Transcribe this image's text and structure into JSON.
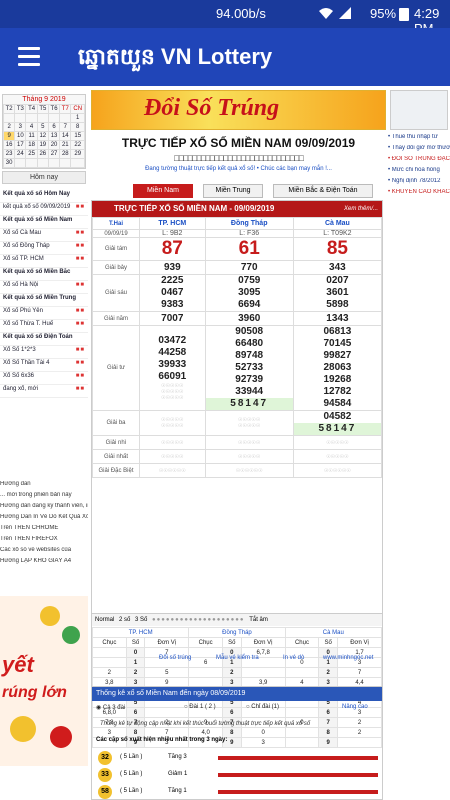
{
  "status": {
    "speed": "94.00b/s",
    "battery": "95%",
    "time": "4:29 PM"
  },
  "app": {
    "title": "ឆ្នោតយួន VN Lottery"
  },
  "left": {
    "calendar_title": "Tháng 9 2019",
    "calendar_days": [
      "T2",
      "T3",
      "T4",
      "T5",
      "T6",
      "T7",
      "CN"
    ],
    "calendar_rows": [
      [
        "",
        "",
        "",
        "",
        "",
        "",
        "1"
      ],
      [
        "2",
        "3",
        "4",
        "5",
        "6",
        "7",
        "8"
      ],
      [
        "9",
        "10",
        "11",
        "12",
        "13",
        "14",
        "15"
      ],
      [
        "16",
        "17",
        "18",
        "19",
        "20",
        "21",
        "22"
      ],
      [
        "23",
        "24",
        "25",
        "26",
        "27",
        "28",
        "29"
      ],
      [
        "30",
        "",
        "",
        "",
        "",
        "",
        ""
      ]
    ],
    "today": "Hôm nay",
    "menu": [
      {
        "text": "Kết quả xổ số Hôm Nay",
        "sec": true
      },
      {
        "text": "kết quả xổ số 09/09/2019",
        "sec": false
      },
      {
        "text": "Kết quả xổ số Miền Nam",
        "sec": true
      },
      {
        "text": "Xổ số Cà Mau",
        "sec": false
      },
      {
        "text": "Xổ số Đồng Tháp",
        "sec": false
      },
      {
        "text": "Xổ số TP. HCM",
        "sec": false
      },
      {
        "text": "Kết quả xổ số Miền Bắc",
        "sec": true
      },
      {
        "text": "Xổ số Hà Nội",
        "sec": false
      },
      {
        "text": "Kết quả xổ số Miền Trung",
        "sec": true
      },
      {
        "text": "Xổ số Phú Yên",
        "sec": false
      },
      {
        "text": "Xổ số Thừa T. Huế",
        "sec": false
      },
      {
        "text": "Kết quả xổ số Điện Toán",
        "sec": true
      },
      {
        "text": "Xổ Số 1*2*3",
        "sec": false
      },
      {
        "text": "Xổ Số Thần Tài 4",
        "sec": false
      },
      {
        "text": "Xổ Số 6x36",
        "sec": false
      },
      {
        "text": "đang xổ, mới",
        "sec": false
      }
    ],
    "bottom": [
      "Hướng dẫn",
      "... mới trong phiên bản này",
      "Hướng dẫn đăng ký thành viên, in",
      "Hướng Dẫn In Vé Dò Kết Quả Xổ",
      "Trên TRÊN CHROME",
      "Trên TRÊN FIREFOX",
      "Các xổ số về websites của",
      "Hướng LẬP KHỔ GIẤY A4"
    ],
    "ad_line1": "yết",
    "ad_line2": "rúng lớn"
  },
  "center": {
    "banner": "Đổi Số Trúng",
    "title": "TRỰC TIẾP XỔ SỐ MIỀN NAM 09/09/2019",
    "boxes": "□□□□□□□□□□□□□□□□□□□□□□□□□□□□□",
    "note": "Đang tường thuật trực tiếp kết quả xổ số! • Chúc các bạn may mắn !...",
    "tabs": [
      "Miền Nam",
      "Miền Trung",
      "Miền Bắc & Điện Toán"
    ],
    "results_head": "TRỰC TIẾP XỔ SỐ MIỀN NAM - 09/09/2019",
    "more": "Xem thêm/...",
    "col_label": "T.Hai",
    "provinces": [
      "TP. HCM",
      "Đồng Tháp",
      "Cà Mau"
    ],
    "date": "09/09/19",
    "codes": [
      "L: 9B2",
      "L: F36",
      "L: T09K2"
    ],
    "prizes": [
      {
        "label": "Giải tám",
        "values": [
          [
            "87"
          ],
          [
            "61"
          ],
          [
            "85"
          ]
        ],
        "big": true
      },
      {
        "label": "Giải bảy",
        "values": [
          [
            "939"
          ],
          [
            "770"
          ],
          [
            "343"
          ]
        ]
      },
      {
        "label": "Giải sáu",
        "values": [
          [
            "2225",
            "0467",
            "9383"
          ],
          [
            "0759",
            "3095",
            "6694"
          ],
          [
            "0207",
            "3601",
            "5898"
          ]
        ]
      },
      {
        "label": "Giải năm",
        "values": [
          [
            "7007"
          ],
          [
            "3960"
          ],
          [
            "1343"
          ]
        ]
      },
      {
        "label": "Giải tư",
        "values": [
          [
            "03472",
            "44258",
            "39933",
            "66091",
            "☉☉☉☉☉",
            "☉☉☉☉☉",
            "☉☉☉☉☉"
          ],
          [
            "90508",
            "66480",
            "89748",
            "52733",
            "92739",
            "33944",
            "58147"
          ],
          [
            "06813",
            "70145",
            "99827",
            "28063",
            "19268",
            "12782",
            "94584"
          ]
        ]
      },
      {
        "label": "Giải ba",
        "values": [
          [
            "☉☉☉☉☉",
            "☉☉☉☉☉"
          ],
          [
            "☉☉☉☉☉",
            "☉☉☉☉☉"
          ],
          [
            "04582",
            "58147"
          ]
        ]
      },
      {
        "label": "Giải nhì",
        "values": [
          [
            "☉☉☉☉☉"
          ],
          [
            "☉☉☉☉☉"
          ],
          [
            "☉☉☉☉☉"
          ]
        ]
      },
      {
        "label": "Giải nhất",
        "values": [
          [
            "☉☉☉☉☉"
          ],
          [
            "☉☉☉☉☉"
          ],
          [
            "☉☉☉☉☉"
          ]
        ]
      },
      {
        "label": "Giải Đặc Biệt",
        "values": [
          [
            "☉☉☉☉☉☉"
          ],
          [
            "☉☉☉☉☉☉"
          ],
          [
            "☉☉☉☉☉☉"
          ]
        ]
      }
    ],
    "ctrl": [
      "Normal",
      "2 số",
      "3 Số",
      "Tắt âm"
    ],
    "digit_head": [
      "Chục",
      "Số",
      "Đơn Vị",
      "Chục",
      "Số",
      "Đơn Vị",
      "Chục",
      "Số",
      "Đơn Vị"
    ],
    "digit_rows": [
      [
        "",
        "0",
        "7",
        "",
        "0",
        "6,7,8",
        "",
        "0",
        "1,7"
      ],
      [
        "",
        "1",
        "",
        "6",
        "1",
        "",
        "0",
        "1",
        "3"
      ],
      [
        "2",
        "2",
        "5",
        "",
        "2",
        "",
        "",
        "2",
        "7"
      ],
      [
        "3,8",
        "3",
        "9",
        "",
        "3",
        "3,9",
        "4",
        "3",
        "4,4"
      ],
      [
        "",
        "4",
        "",
        "",
        "4",
        "8,4",
        "4",
        "4",
        "3"
      ],
      [
        "",
        "5",
        "",
        "",
        "5",
        "",
        "",
        "5",
        "4"
      ],
      [
        "6,8,0",
        "6",
        "",
        "",
        "6",
        "",
        "",
        "6",
        "3"
      ],
      [
        "7,8",
        "7",
        "2",
        "9",
        "7",
        "",
        "0",
        "7",
        "2"
      ],
      [
        "3",
        "8",
        "7",
        "4,0",
        "8",
        "0",
        "",
        "8",
        "2"
      ],
      [
        "",
        "9",
        "3",
        "",
        "9",
        "3",
        "",
        "9",
        ""
      ]
    ],
    "links": [
      "Đổi số trúng",
      "Mẫu vé kiểm tra",
      "In vé dò",
      "www.minhngoc.net"
    ],
    "stats_head": "Thống kê xổ số Miền Nam đến ngày 08/09/2019",
    "stats_opts": [
      "Cả 3 đài",
      "Đài 1 ( 2 )",
      "Chỉ đài (1)",
      "Nâng cao"
    ],
    "stats_note": "Thống kê tự động cập nhật khi kết thúc buổi tường thuật trực tiếp kết quả xổ số",
    "stats_q": "Các cặp số xuất hiện nhiều nhất trong 3 ngày:",
    "stats_rows": [
      {
        "n": "32",
        "times": "( 5 Lần )",
        "trend": "Tăng 3"
      },
      {
        "n": "33",
        "times": "( 5 Lần )",
        "trend": "Giảm 1"
      },
      {
        "n": "58",
        "times": "( 5 Lần )",
        "trend": "Tăng 1"
      }
    ]
  },
  "right": {
    "items": [
      "Thuế thu nhập từ",
      "Thay đổi giờ mở thưởng",
      "ĐỔI SỐ TRÚNG ĐẶC BIỆT",
      "Mức chi hoa hồng",
      "Nghị định 78/2012",
      "KHUYẾN CÁO KHÁCH HÀNG"
    ]
  }
}
